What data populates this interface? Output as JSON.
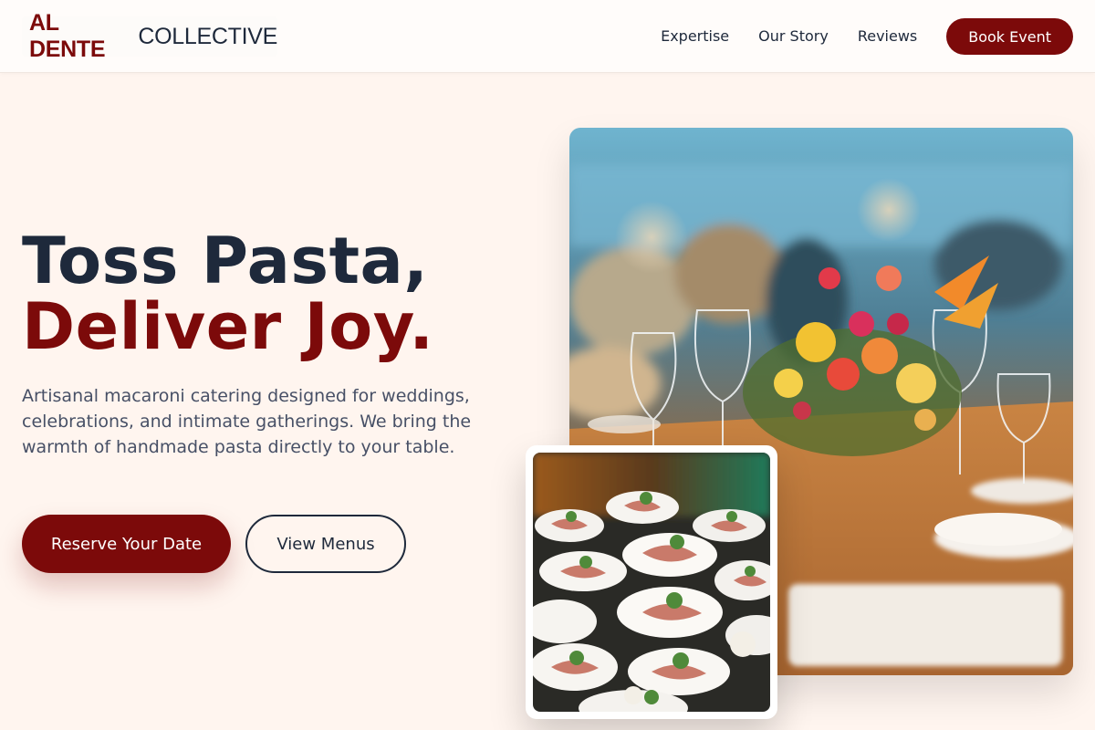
{
  "brand": {
    "name_bold": "AL DENTE",
    "name_light": "COLLECTIVE"
  },
  "nav": {
    "links": [
      "Expertise",
      "Our Story",
      "Reviews"
    ],
    "cta": "Book Event"
  },
  "hero": {
    "title_line1": "Toss Pasta,",
    "title_line2": "Deliver Joy.",
    "subtitle": "Artisanal macaroni catering designed for weddings, celebrations, and intimate gatherings. We bring the warmth of handmade pasta directly to your table.",
    "primary_cta": "Reserve Your Date",
    "secondary_cta": "View Menus"
  },
  "images": {
    "main_alt": "banquet-table-photo",
    "card_alt": "plated-appetizers-photo"
  },
  "colors": {
    "accent": "#7c0a0a",
    "text_dark": "#1e293b",
    "background": "#fff5ef"
  }
}
